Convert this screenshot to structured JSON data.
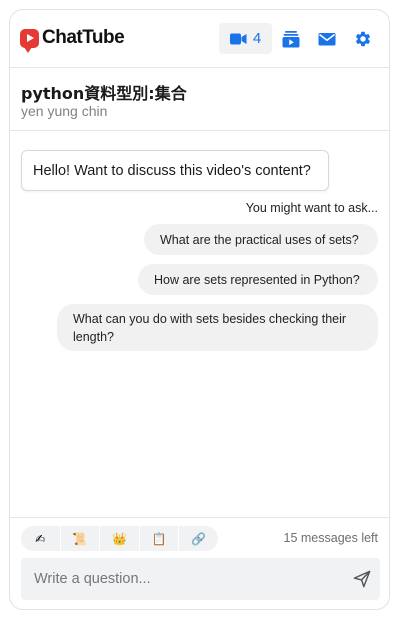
{
  "app": {
    "name": "ChatTube",
    "brand_color": "#e53935",
    "accent_color": "#1a73e8"
  },
  "header": {
    "video_count": "4",
    "icons": [
      "video-camera-icon",
      "playlist-icon",
      "mail-icon",
      "gear-icon"
    ]
  },
  "video": {
    "title": "python資料型別:集合",
    "author": "yen yung chin"
  },
  "chat": {
    "greeting": "Hello! Want to discuss this video's content?",
    "suggest_hint": "You might want to ask...",
    "suggestions": [
      "What are the practical uses of sets?",
      "How are sets represented in Python?",
      "What can you do with sets besides checking their length?"
    ]
  },
  "tools": {
    "items": [
      "✍",
      "📜",
      "👑",
      "📋",
      "🔗"
    ]
  },
  "footer": {
    "messages_left": "15 messages left",
    "input_placeholder": "Write a question..."
  }
}
